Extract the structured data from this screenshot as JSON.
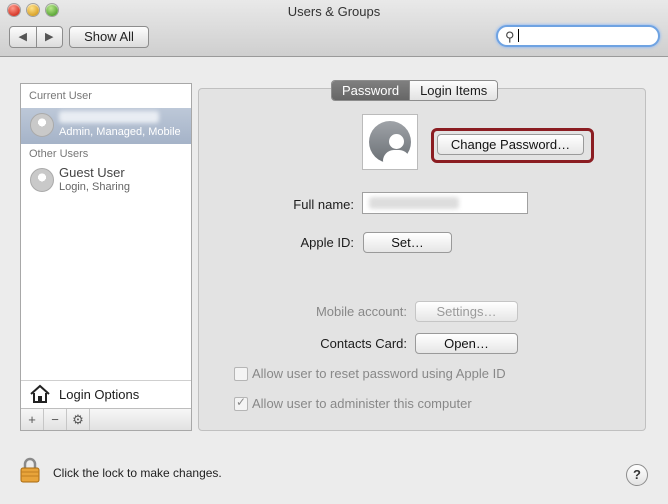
{
  "window": {
    "title": "Users & Groups"
  },
  "toolbar": {
    "back_icon": "◀",
    "forward_icon": "▶",
    "show_all_label": "Show All",
    "search": {
      "value": "",
      "placeholder": ""
    }
  },
  "sidebar": {
    "current_user_header": "Current User",
    "current_user": {
      "role": "Admin, Managed, Mobile"
    },
    "other_users_header": "Other Users",
    "guest": {
      "name": "Guest User",
      "detail": "Login, Sharing"
    },
    "login_options_label": "Login Options",
    "bar": {
      "add": "+",
      "remove": "−",
      "gear": "⚙"
    }
  },
  "tabs": [
    {
      "label": "Password",
      "active": true
    },
    {
      "label": "Login Items",
      "active": false
    }
  ],
  "panel": {
    "change_password_label": "Change Password…",
    "full_name_label": "Full name:",
    "apple_id_label": "Apple ID:",
    "apple_id_button": "Set…",
    "mobile_account_label": "Mobile account:",
    "mobile_account_button": "Settings…",
    "contacts_card_label": "Contacts Card:",
    "contacts_card_button": "Open…",
    "reset_password_label": "Allow user to reset password using Apple ID",
    "reset_password_checked": false,
    "administer_label": "Allow user to administer this computer",
    "administer_checked": true
  },
  "footer": {
    "lock_text": "Click the lock to make changes.",
    "help_label": "?"
  },
  "colors": {
    "selection": "#a5b3c8",
    "highlight_ring": "#8b1d22",
    "search_focus": "#6fa3e2"
  }
}
